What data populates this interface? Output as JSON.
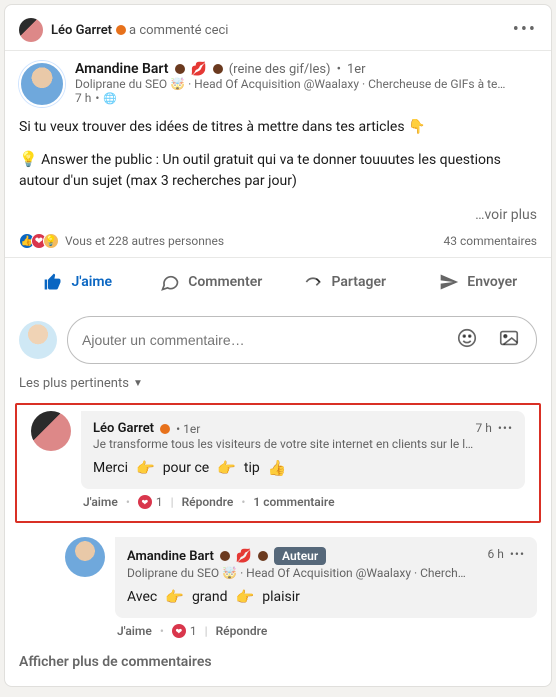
{
  "promoted": {
    "actor_name": "Léo Garret",
    "action_text": "a commenté ceci"
  },
  "post": {
    "author_name": "Amandine Bart",
    "tagline_suffix": "(reine des gif/les)",
    "degree": "1er",
    "headline": "Doliprane du SEO 🤯 · Head Of Acquisition @Waalaxy · Chercheuse de GIFs à te…",
    "time": "7 h",
    "body_line1": "Si tu veux trouver des idées de titres à mettre dans tes articles 👇",
    "body_line2_prefix": "💡",
    "body_line2": "Answer the public : Un outil gratuit qui va te donner touuutes les questions autour d'un sujet (max 3 recherches par jour)",
    "see_more": "…voir plus",
    "reactions_text": "Vous et 228 autres personnes",
    "comments_count": "43 commentaires"
  },
  "actions": {
    "like": "J'aime",
    "comment": "Commenter",
    "share": "Partager",
    "send": "Envoyer"
  },
  "comment_input": {
    "placeholder": "Ajouter un commentaire…"
  },
  "sort": {
    "label": "Les plus pertinents"
  },
  "comments": [
    {
      "author": "Léo Garret",
      "degree": "1er",
      "time": "7 h",
      "headline": "Je transforme tous les visiteurs de votre site internet en clients sur le lo…",
      "text_parts": [
        "Merci",
        "👉",
        "pour ce",
        "👉",
        "tip",
        "👍"
      ],
      "like_count": "1",
      "replies_label": "1 commentaire",
      "actions": {
        "like": "J'aime",
        "reply": "Répondre"
      }
    },
    {
      "author": "Amandine Bart",
      "author_badge": "Auteur",
      "time": "6 h",
      "headline": "Doliprane du SEO 🤯 · Head Of Acquisition @Waalaxy · Cherch…",
      "text_parts": [
        "Avec",
        "👉",
        "grand",
        "👉",
        "plaisir"
      ],
      "like_count": "1",
      "actions": {
        "like": "J'aime",
        "reply": "Répondre"
      }
    }
  ],
  "show_more": "Afficher plus de commentaires"
}
